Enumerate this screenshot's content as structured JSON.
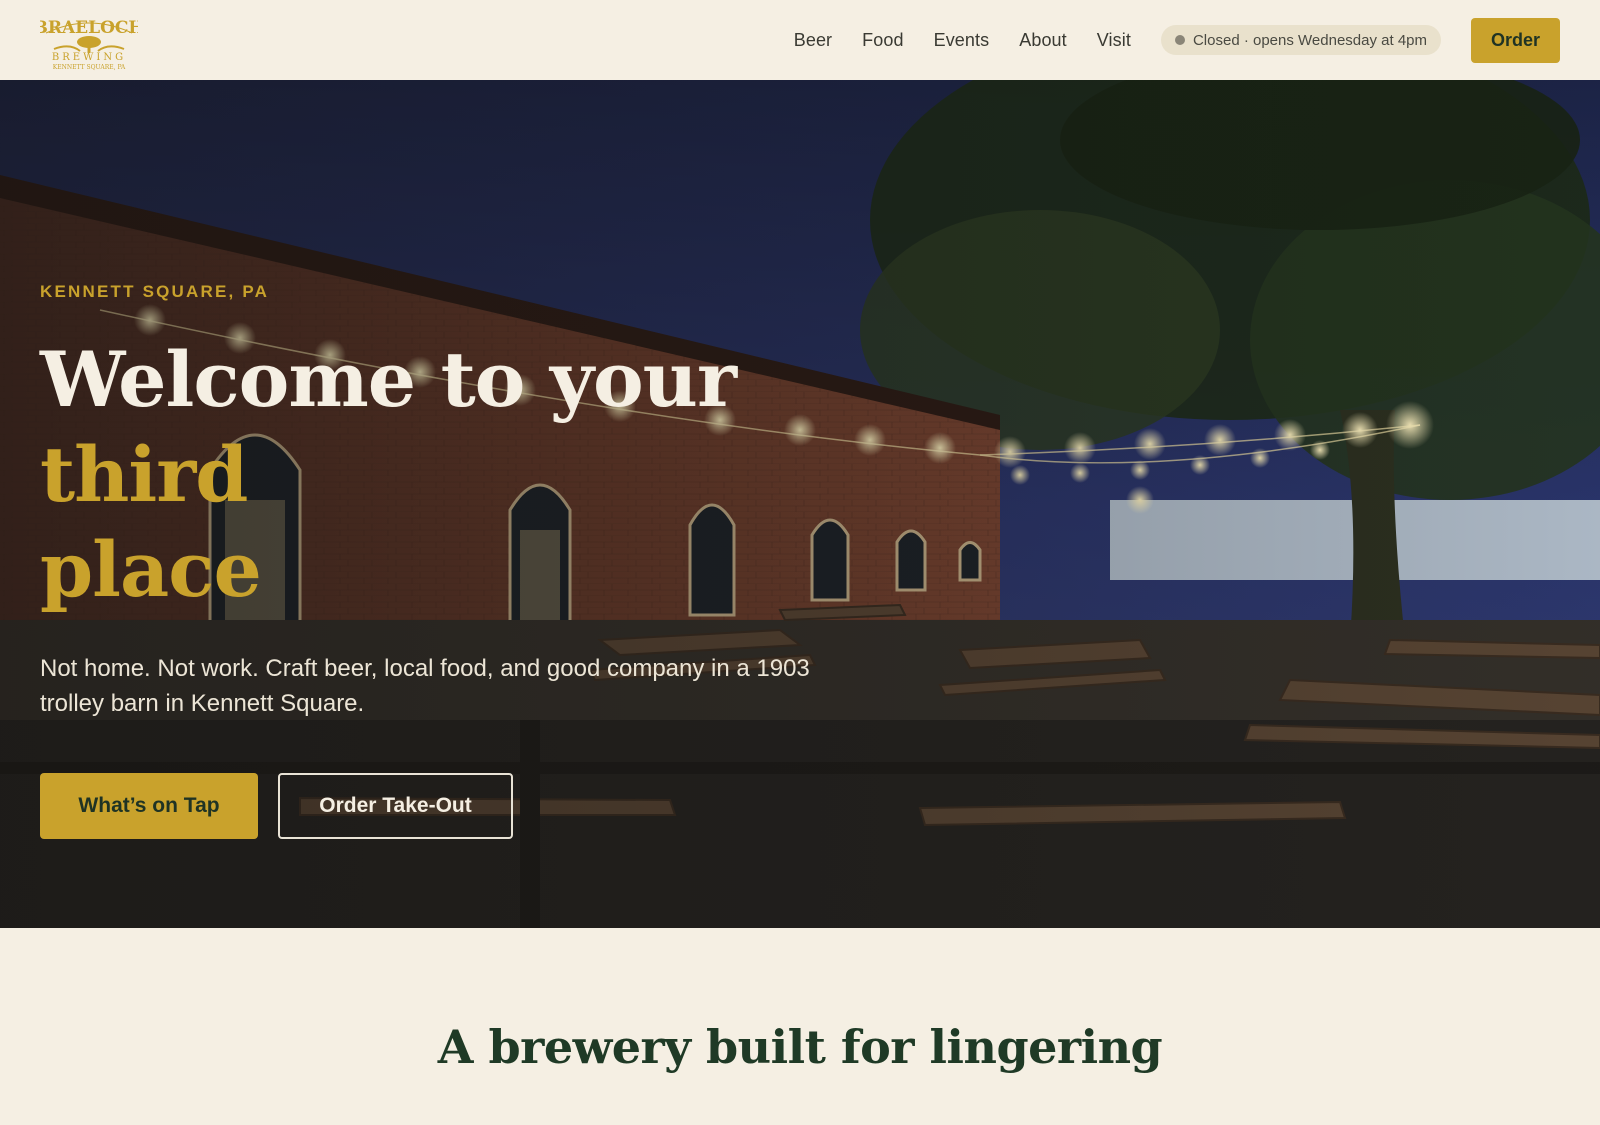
{
  "brand": {
    "logo_name": "BRAELOCH",
    "logo_sub": "BREWING",
    "logo_location": "KENNETT SQUARE, PA"
  },
  "nav": {
    "links": [
      "Beer",
      "Food",
      "Events",
      "About",
      "Visit"
    ],
    "status": "Closed · opens Wednesday at 4pm",
    "order_label": "Order"
  },
  "hero": {
    "eyebrow": "KENNETT SQUARE, PA",
    "title_main": "Welcome to your ",
    "title_accent_1": "third",
    "title_accent_2": "place",
    "subtitle": "Not home. Not work. Craft beer, local food, and good company in a 1903 trolley barn in Kennett Square.",
    "primary_cta": "What’s on Tap",
    "secondary_cta": "Order Take-Out"
  },
  "section": {
    "title": "A brewery built for lingering"
  },
  "colors": {
    "accent": "#c9a22c",
    "background": "#f5efe3",
    "heading": "#1f3a26"
  }
}
